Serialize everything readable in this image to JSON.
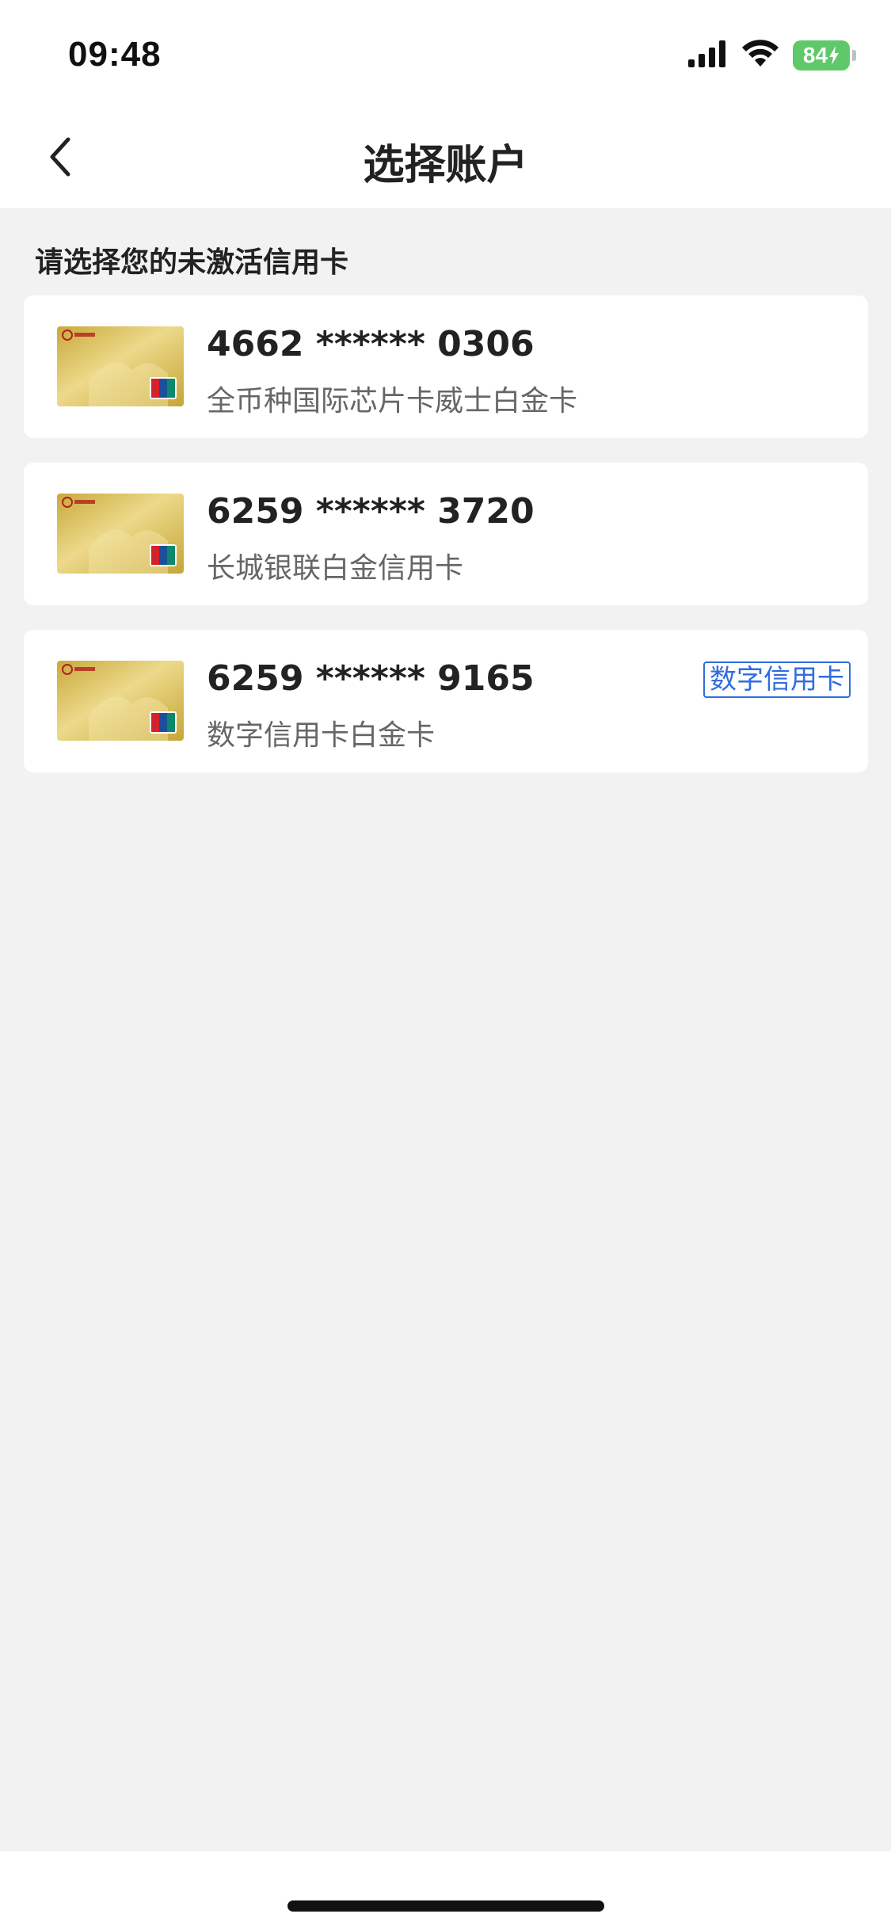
{
  "status_bar": {
    "time": "09:48",
    "battery_level": "84",
    "icons": [
      "signal-icon",
      "wifi-icon",
      "battery-icon",
      "charging-icon"
    ]
  },
  "nav": {
    "title": "选择账户",
    "back_icon": "chevron-left-icon"
  },
  "section": {
    "label": "请选择您的未激活信用卡"
  },
  "cards": [
    {
      "number": "4662 ****** 0306",
      "name": "全币种国际芯片卡威士白金卡",
      "badge": ""
    },
    {
      "number": "6259 ****** 3720",
      "name": "长城银联白金信用卡",
      "badge": ""
    },
    {
      "number": "6259 ****** 9165",
      "name": "数字信用卡白金卡",
      "badge": "数字信用卡"
    }
  ],
  "colors": {
    "background": "#f2f2f2",
    "surface": "#ffffff",
    "badge_blue": "#2f6de0",
    "battery_green": "#5fc86b",
    "card_gold": "#d8bf5a"
  }
}
